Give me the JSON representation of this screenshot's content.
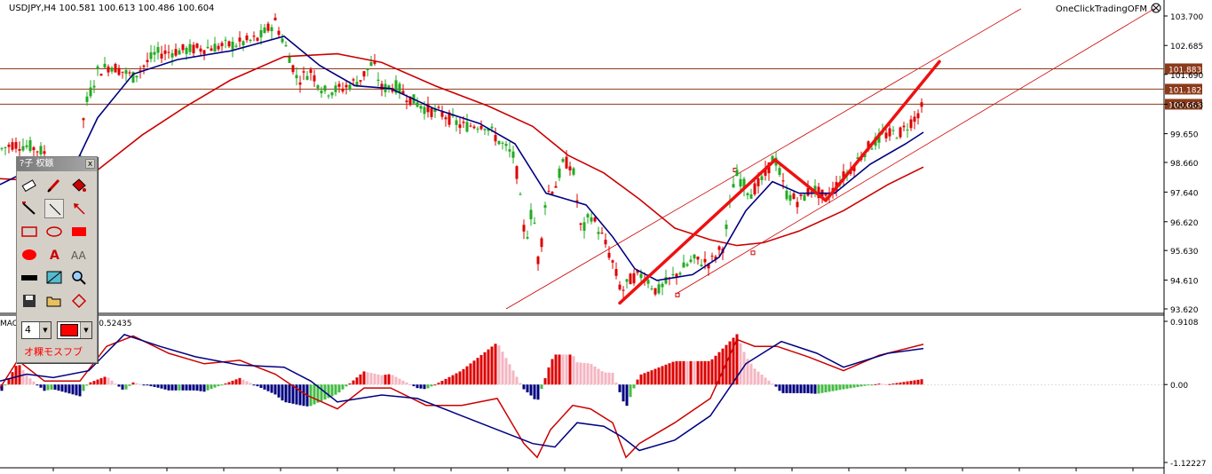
{
  "header": {
    "symbol_info": "USDJPY,H4  100.581 100.613 100.486 100.604",
    "ea_name": "OneClickTradingOFM"
  },
  "colors": {
    "bull": "#22aa22",
    "bear": "#dd0000",
    "ma_fast": "#000080",
    "ma_slow": "#cc0000",
    "hline": "#8b3a1a",
    "trend": "#ee1111",
    "channel": "#cc0000",
    "macd_pos_strong": "#dd0000",
    "macd_pos_weak": "#f4b6c2",
    "macd_neg_strong": "#000080",
    "macd_neg_weak": "#44bb44"
  },
  "price_axis": {
    "ticks": [
      "103.700",
      "102.685",
      "101.690",
      "100.663",
      "99.650",
      "98.660",
      "97.640",
      "96.620",
      "95.630",
      "94.610",
      "93.620"
    ],
    "tick_values": [
      103.7,
      102.685,
      101.69,
      100.663,
      99.65,
      98.66,
      97.64,
      96.62,
      95.63,
      94.61,
      93.62
    ],
    "range": [
      93.62,
      103.7
    ]
  },
  "horizontal_levels": [
    {
      "label": "101.883",
      "value": 101.883
    },
    {
      "label": "101.182",
      "value": 101.182
    },
    {
      "label": "100.663",
      "value": 100.663
    }
  ],
  "macd_panel": {
    "label": "MACD(12,26,9) 0.58528 0.52435",
    "ticks": [
      "0.9108",
      "0.00",
      "-1.12227"
    ],
    "tick_values": [
      0.9108,
      0.0,
      -1.12227
    ],
    "range": [
      -1.12227,
      0.9108
    ]
  },
  "toolbar": {
    "title": "?子 权鏃",
    "close": "x",
    "size_value": "4",
    "dropdown_arrow": "▼",
    "footer_label": "オ粿モスフブ",
    "tools": [
      {
        "name": "eraser-icon"
      },
      {
        "name": "pen-icon"
      },
      {
        "name": "paint-bucket-icon"
      },
      {
        "name": "pencil-line-icon"
      },
      {
        "name": "line-tool-icon"
      },
      {
        "name": "arrow-tool-icon"
      },
      {
        "name": "rectangle-outline-icon"
      },
      {
        "name": "ellipse-outline-icon"
      },
      {
        "name": "rectangle-filled-icon"
      },
      {
        "name": "ellipse-filled-icon"
      },
      {
        "name": "text-tool-icon"
      },
      {
        "name": "font-size-icon"
      },
      {
        "name": "color-bar-icon"
      },
      {
        "name": "screenshot-icon"
      },
      {
        "name": "zoom-icon"
      },
      {
        "name": "save-icon"
      },
      {
        "name": "open-folder-icon"
      },
      {
        "name": "diamond-icon"
      }
    ]
  },
  "chart_data": {
    "type": "candlestick",
    "title": "USDJPY,H4  100.581 100.613 100.486 100.604",
    "ylim": [
      93.62,
      103.7
    ],
    "grid": false,
    "price_path": [
      [
        0,
        99.1
      ],
      [
        15,
        99.3
      ],
      [
        35,
        99.2
      ],
      [
        50,
        99.0
      ],
      [
        70,
        98.2
      ],
      [
        88,
        98.0
      ],
      [
        95,
        100.5
      ],
      [
        110,
        101.8
      ],
      [
        125,
        102.0
      ],
      [
        150,
        101.6
      ],
      [
        175,
        102.4
      ],
      [
        200,
        102.5
      ],
      [
        230,
        102.6
      ],
      [
        260,
        102.7
      ],
      [
        290,
        102.9
      ],
      [
        310,
        103.5
      ],
      [
        325,
        102.4
      ],
      [
        335,
        101.5
      ],
      [
        350,
        101.8
      ],
      [
        365,
        101.1
      ],
      [
        385,
        101.2
      ],
      [
        405,
        101.5
      ],
      [
        420,
        102.1
      ],
      [
        430,
        101.2
      ],
      [
        445,
        101.3
      ],
      [
        460,
        100.9
      ],
      [
        480,
        100.5
      ],
      [
        500,
        100.3
      ],
      [
        520,
        99.9
      ],
      [
        545,
        100.0
      ],
      [
        565,
        99.3
      ],
      [
        580,
        98.8
      ],
      [
        592,
        95.9
      ],
      [
        600,
        97.2
      ],
      [
        607,
        95.0
      ],
      [
        615,
        97.6
      ],
      [
        625,
        97.8
      ],
      [
        635,
        98.7
      ],
      [
        645,
        98.5
      ],
      [
        655,
        96.2
      ],
      [
        665,
        96.9
      ],
      [
        680,
        96.0
      ],
      [
        690,
        95.2
      ],
      [
        700,
        94.2
      ],
      [
        712,
        94.7
      ],
      [
        725,
        94.8
      ],
      [
        740,
        94.2
      ],
      [
        750,
        94.5
      ],
      [
        765,
        94.9
      ],
      [
        780,
        95.3
      ],
      [
        800,
        95.2
      ],
      [
        815,
        95.8
      ],
      [
        828,
        98.3
      ],
      [
        845,
        97.6
      ],
      [
        860,
        98.1
      ],
      [
        872,
        98.9
      ],
      [
        885,
        97.6
      ],
      [
        900,
        97.3
      ],
      [
        915,
        97.8
      ],
      [
        930,
        97.4
      ],
      [
        945,
        98.0
      ],
      [
        960,
        98.5
      ],
      [
        975,
        99.1
      ],
      [
        995,
        99.6
      ],
      [
        1015,
        99.7
      ],
      [
        1030,
        100.2
      ],
      [
        1040,
        100.6
      ]
    ],
    "ma_fast_path": [
      [
        0,
        97.9
      ],
      [
        40,
        98.5
      ],
      [
        85,
        98.6
      ],
      [
        110,
        100.2
      ],
      [
        150,
        101.7
      ],
      [
        200,
        102.2
      ],
      [
        260,
        102.5
      ],
      [
        320,
        103.0
      ],
      [
        360,
        102.0
      ],
      [
        400,
        101.3
      ],
      [
        440,
        101.2
      ],
      [
        490,
        100.5
      ],
      [
        540,
        100.0
      ],
      [
        580,
        99.3
      ],
      [
        615,
        97.6
      ],
      [
        660,
        97.2
      ],
      [
        690,
        96.1
      ],
      [
        715,
        95.0
      ],
      [
        740,
        94.6
      ],
      [
        780,
        94.8
      ],
      [
        810,
        95.4
      ],
      [
        840,
        97.0
      ],
      [
        870,
        98.0
      ],
      [
        900,
        97.6
      ],
      [
        940,
        97.6
      ],
      [
        980,
        98.6
      ],
      [
        1020,
        99.3
      ],
      [
        1040,
        99.7
      ]
    ],
    "ma_slow_path": [
      [
        0,
        98.1
      ],
      [
        60,
        98.0
      ],
      [
        110,
        98.4
      ],
      [
        160,
        99.6
      ],
      [
        210,
        100.6
      ],
      [
        260,
        101.5
      ],
      [
        320,
        102.3
      ],
      [
        380,
        102.4
      ],
      [
        430,
        102.1
      ],
      [
        490,
        101.3
      ],
      [
        550,
        100.6
      ],
      [
        600,
        99.9
      ],
      [
        640,
        98.9
      ],
      [
        680,
        98.3
      ],
      [
        720,
        97.4
      ],
      [
        760,
        96.4
      ],
      [
        800,
        96.0
      ],
      [
        830,
        95.8
      ],
      [
        860,
        95.9
      ],
      [
        900,
        96.3
      ],
      [
        950,
        97.0
      ],
      [
        1000,
        97.9
      ],
      [
        1040,
        98.5
      ]
    ],
    "trend_lines": [
      {
        "from": [
          698,
          93.82
        ],
        "to": [
          873,
          98.75
        ]
      },
      {
        "from": [
          873,
          98.75
        ],
        "to": [
          930,
          97.35
        ]
      },
      {
        "from": [
          930,
          97.35
        ],
        "to": [
          1058,
          102.13
        ]
      }
    ],
    "channel_lines": [
      {
        "from": [
          570,
          93.62
        ],
        "to": [
          1150,
          103.95
        ]
      },
      {
        "from": [
          762,
          94.15
        ],
        "to": [
          1300,
          103.95
        ]
      }
    ],
    "channel_points": [
      [
        828,
        98.4
      ],
      [
        848,
        95.55
      ],
      [
        763,
        94.1
      ]
    ],
    "macd": {
      "ylim": [
        -1.12227,
        0.9108
      ],
      "zero": 0,
      "line1_path": [
        [
          0,
          -0.05
        ],
        [
          20,
          0.35
        ],
        [
          50,
          0.05
        ],
        [
          90,
          0.05
        ],
        [
          120,
          0.55
        ],
        [
          150,
          0.7
        ],
        [
          190,
          0.45
        ],
        [
          230,
          0.3
        ],
        [
          270,
          0.35
        ],
        [
          310,
          0.15
        ],
        [
          345,
          -0.15
        ],
        [
          380,
          -0.35
        ],
        [
          410,
          -0.05
        ],
        [
          440,
          -0.05
        ],
        [
          480,
          -0.3
        ],
        [
          520,
          -0.3
        ],
        [
          560,
          -0.2
        ],
        [
          590,
          -0.85
        ],
        [
          605,
          -1.05
        ],
        [
          620,
          -0.65
        ],
        [
          645,
          -0.3
        ],
        [
          665,
          -0.35
        ],
        [
          690,
          -0.55
        ],
        [
          705,
          -1.05
        ],
        [
          720,
          -0.85
        ],
        [
          760,
          -0.55
        ],
        [
          800,
          -0.2
        ],
        [
          830,
          0.65
        ],
        [
          850,
          0.55
        ],
        [
          875,
          0.55
        ],
        [
          910,
          0.4
        ],
        [
          950,
          0.2
        ],
        [
          990,
          0.42
        ],
        [
          1040,
          0.58
        ]
      ],
      "line2_path": [
        [
          0,
          0.05
        ],
        [
          30,
          0.15
        ],
        [
          60,
          0.1
        ],
        [
          100,
          0.2
        ],
        [
          140,
          0.72
        ],
        [
          180,
          0.55
        ],
        [
          220,
          0.4
        ],
        [
          270,
          0.28
        ],
        [
          320,
          0.25
        ],
        [
          350,
          0.05
        ],
        [
          380,
          -0.25
        ],
        [
          430,
          -0.15
        ],
        [
          470,
          -0.2
        ],
        [
          520,
          -0.45
        ],
        [
          560,
          -0.65
        ],
        [
          600,
          -0.85
        ],
        [
          625,
          -0.9
        ],
        [
          650,
          -0.55
        ],
        [
          680,
          -0.6
        ],
        [
          700,
          -0.75
        ],
        [
          720,
          -0.95
        ],
        [
          760,
          -0.8
        ],
        [
          800,
          -0.45
        ],
        [
          840,
          0.3
        ],
        [
          880,
          0.62
        ],
        [
          920,
          0.45
        ],
        [
          950,
          0.25
        ],
        [
          1000,
          0.45
        ],
        [
          1040,
          0.52
        ]
      ]
    }
  }
}
